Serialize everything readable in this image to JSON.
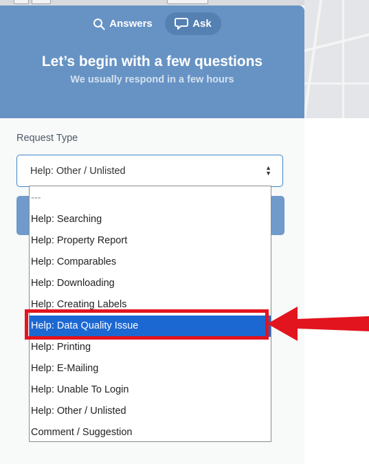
{
  "nav": {
    "answers_label": "Answers",
    "ask_label": "Ask",
    "answers_icon": "search-icon",
    "ask_icon": "speech-bubble-icon"
  },
  "header": {
    "title": "Let’s begin with a few questions",
    "subtitle": "We usually respond in a few hours"
  },
  "form": {
    "request_type_label": "Request Type",
    "selected_value": "Help: Other / Unlisted"
  },
  "dropdown": {
    "options": [
      "---",
      "Help: Searching",
      "Help: Property Report",
      "Help: Comparables",
      "Help: Downloading",
      "Help: Creating Labels",
      "Help: Data Quality Issue",
      "Help: Printing",
      "Help: E-Mailing",
      "Help: Unable To Login",
      "Help: Other / Unlisted",
      "Comment / Suggestion"
    ],
    "highlighted_option": "Help: Data Quality Issue"
  },
  "colors": {
    "header_bg": "#6793c4",
    "selected_option_bg": "#1c68d3",
    "annotation_red": "#e2141e"
  }
}
